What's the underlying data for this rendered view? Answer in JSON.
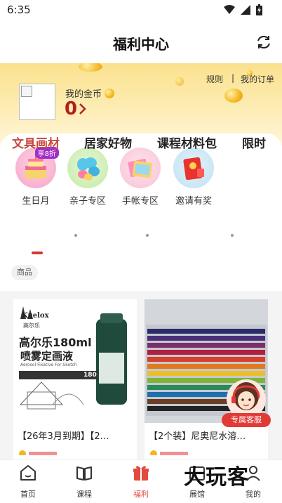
{
  "status_bar": {
    "time": "6:35"
  },
  "header": {
    "title": "福利中心",
    "refresh_icon": "refresh-icon"
  },
  "hero": {
    "rules_label": "规则",
    "separator": "|",
    "my_orders_label": "我的订单",
    "coins_label": "我的金币",
    "coins_value": "0",
    "coin_color": "#f5b51f",
    "value_color": "#b3201c"
  },
  "categories": [
    {
      "label": "生日月",
      "badge": "享8折",
      "icon": "birthday-cake-icon"
    },
    {
      "label": "亲子专区",
      "icon": "balloon-animal-icon"
    },
    {
      "label": "手帐专区",
      "icon": "stickers-icon"
    },
    {
      "label": "邀请有奖",
      "icon": "red-envelope-icon"
    }
  ],
  "tabs": [
    {
      "label": "文具画材",
      "active": true
    },
    {
      "label": "居家好物"
    },
    {
      "label": "课程材料包"
    },
    {
      "label": "限时"
    }
  ],
  "filter_chip": "商品",
  "products": [
    {
      "title": "【26年3月到期】【2…",
      "image_brand": "Kuelox",
      "image_brand_cn": "高尔乐",
      "image_headline_1": "高尔乐180ml",
      "image_headline_2": "喷雾定画液",
      "image_subtitle": "Aerosol Fixative For Sketch",
      "image_tag": "180"
    },
    {
      "title": "【2个装】尼奥尼水溶…",
      "image_desc": "colored-pencils-tin"
    }
  ],
  "service_label": "专属客服",
  "bottom_nav": [
    {
      "label": "首页",
      "icon": "home-icon"
    },
    {
      "label": "课程",
      "icon": "book-icon"
    },
    {
      "label": "福利",
      "icon": "gift-icon",
      "active": true
    },
    {
      "label": "展馆",
      "icon": "gallery-icon"
    },
    {
      "label": "我的",
      "icon": "profile-icon"
    }
  ],
  "watermark": "大玩客",
  "accent_color": "#d33b30"
}
